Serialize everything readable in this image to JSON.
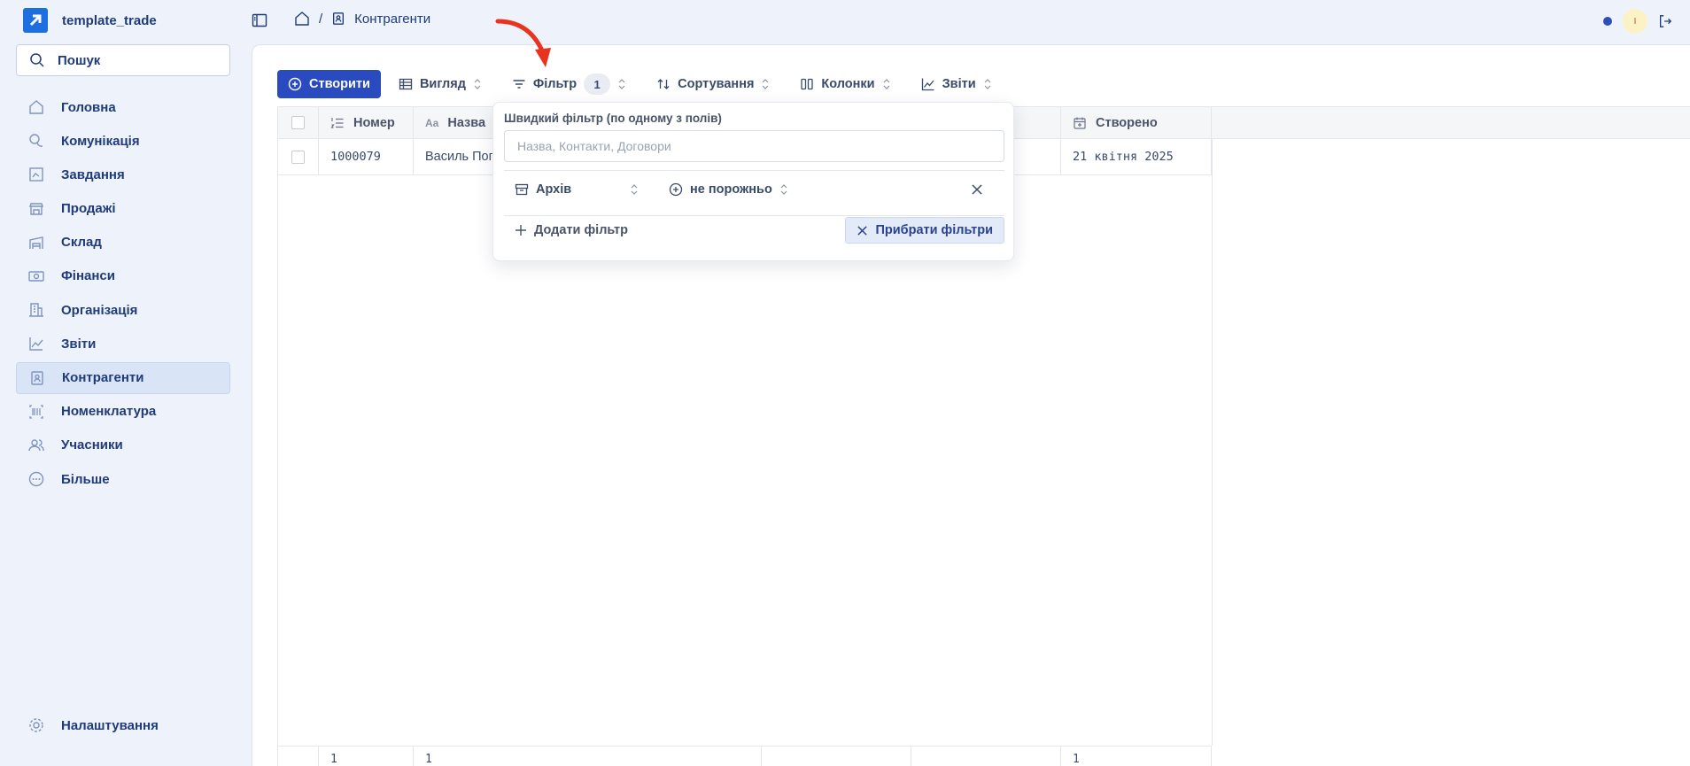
{
  "app": {
    "name": "template_trade"
  },
  "search": {
    "label": "Пошук"
  },
  "sidebar": {
    "items": [
      {
        "label": "Головна",
        "icon": "home-icon"
      },
      {
        "label": "Комунікація",
        "icon": "chat-icon"
      },
      {
        "label": "Завдання",
        "icon": "task-icon"
      },
      {
        "label": "Продажі",
        "icon": "store-icon"
      },
      {
        "label": "Склад",
        "icon": "warehouse-icon"
      },
      {
        "label": "Фінанси",
        "icon": "money-icon"
      },
      {
        "label": "Організація",
        "icon": "building-icon"
      },
      {
        "label": "Звіти",
        "icon": "chart-icon"
      },
      {
        "label": "Контрагенти",
        "icon": "contact-icon",
        "active": true
      },
      {
        "label": "Номенклатура",
        "icon": "barcode-icon"
      },
      {
        "label": "Учасники",
        "icon": "users-icon"
      },
      {
        "label": "Більше",
        "icon": "more-icon"
      }
    ],
    "settings_label": "Налаштування"
  },
  "breadcrumb": {
    "separator": "/",
    "current": "Контрагенти"
  },
  "user": {
    "initial": "I"
  },
  "toolbar": {
    "create_label": "Створити",
    "view_label": "Вигляд",
    "filter_label": "Фільтр",
    "filter_count": "1",
    "sort_label": "Сортування",
    "columns_label": "Колонки",
    "reports_label": "Звіти"
  },
  "table": {
    "headers": [
      "Номер",
      "Назва",
      "",
      "",
      "Створено"
    ],
    "rows": [
      {
        "number": "1000079",
        "name": "Василь Поп",
        "col3": "",
        "col4": "",
        "created": "21 квітня 2025"
      }
    ],
    "footer": [
      "1",
      "1",
      "",
      "",
      "1"
    ]
  },
  "filter_popover": {
    "title": "Швидкий фільтр (по одному з полів)",
    "placeholder": "Назва, Контакти, Договори",
    "condition": {
      "field": "Архів",
      "operator": "не порожньо"
    },
    "add_filter_label": "Додати фільтр",
    "clear_filters_label": "Прибрати фільтри"
  },
  "colors": {
    "accent": "#2a4bbf",
    "annotation_arrow": "#e8331f",
    "sidebar_bg": "#eef2fa"
  }
}
